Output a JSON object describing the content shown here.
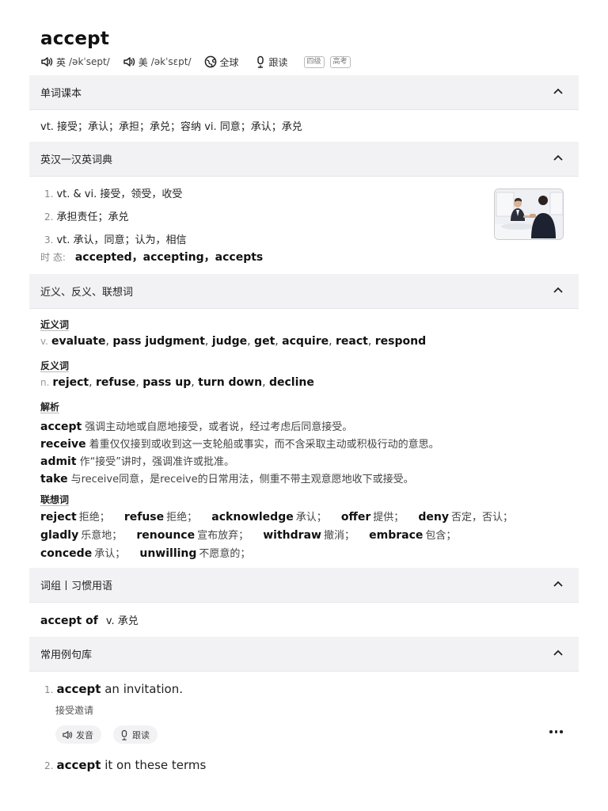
{
  "word": "accept",
  "pronunciation": {
    "uk_label": "英",
    "uk_ipa": "/əkˈsept/",
    "us_label": "美",
    "us_ipa": "/əkˈsɛpt/",
    "global_label": "全球",
    "follow_read_label": "跟读",
    "tags": [
      "四级",
      "高考"
    ]
  },
  "sections": {
    "textbook": {
      "title": "单词课本",
      "definition": "vt. 接受；承认；承担；承兑；容纳 vi. 同意；承认；承兑"
    },
    "dictionary": {
      "title": "英汉一汉英词典",
      "senses": [
        {
          "num": "1.",
          "text": "vt. & vi. 接受，领受，收受"
        },
        {
          "num": "2.",
          "text": "承担责任；承兑"
        },
        {
          "num": "3.",
          "text": "vt. 承认，同意；认为，相信"
        }
      ],
      "tense_label": "时 态:",
      "tense_forms": "accepted，accepting，accepts"
    },
    "related": {
      "title": "近义、反义、联想词",
      "synonyms_label": "近义词",
      "synonyms_pos": "v.",
      "synonyms": [
        "evaluate",
        "pass judgment",
        "judge",
        "get",
        "acquire",
        "react",
        "respond"
      ],
      "antonyms_label": "反义词",
      "antonyms_pos": "n.",
      "antonyms": [
        "reject",
        "refuse",
        "pass up",
        "turn down",
        "decline"
      ],
      "analysis_label": "解析",
      "analysis": [
        {
          "word": "accept",
          "text": "强调主动地或自愿地接受，或者说，经过考虑后同意接受。"
        },
        {
          "word": "receive",
          "text": "着重仅仅接到或收到这一支轮船或事实，而不含采取主动或积极行动的意思。"
        },
        {
          "word": "admit",
          "text": "作“接受”讲时，强调准许或批准。"
        },
        {
          "word": "take",
          "text": "与receive同意，是receive的日常用法，侧重不带主观意愿地收下或接受。"
        }
      ],
      "association_label": "联想词",
      "associations": [
        {
          "word": "reject",
          "text": "拒绝；"
        },
        {
          "word": "refuse",
          "text": "拒绝；"
        },
        {
          "word": "acknowledge",
          "text": "承认；"
        },
        {
          "word": "offer",
          "text": "提供；"
        },
        {
          "word": "deny",
          "text": "否定，否认；"
        },
        {
          "word": "gladly",
          "text": "乐意地；"
        },
        {
          "word": "renounce",
          "text": "宣布放弃；"
        },
        {
          "word": "withdraw",
          "text": "撤消；"
        },
        {
          "word": "embrace",
          "text": "包含；"
        },
        {
          "word": "concede",
          "text": "承认；"
        },
        {
          "word": "unwilling",
          "text": "不愿意的；"
        }
      ]
    },
    "phrases": {
      "title": "词组丨习惯用语",
      "items": [
        {
          "phrase": "accept of",
          "meaning": "v. 承兑"
        }
      ]
    },
    "examples": {
      "title": "常用例句库",
      "items": [
        {
          "num": "1.",
          "word": "accept",
          "rest": " an invitation.",
          "translation": "接受邀请"
        },
        {
          "num": "2.",
          "word": "accept",
          "rest": " it on these terms"
        }
      ],
      "pronounce_label": "发音",
      "follow_label": "跟读"
    }
  }
}
